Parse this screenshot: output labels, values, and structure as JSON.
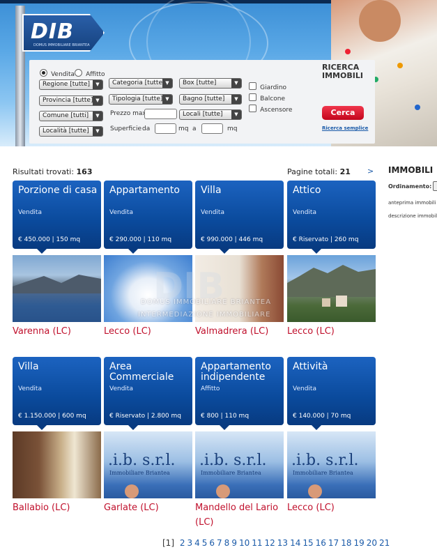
{
  "header": {
    "logo": "DIB",
    "logo_sub": "DOMUS IMMOBILIARE BRIANTEA",
    "search_title": "RICERCA IMMOBILI",
    "search_button": "Cerca",
    "simple_search_link": "Ricerca semplice",
    "radio": [
      {
        "label": "Vendita",
        "checked": true
      },
      {
        "label": "Affitto",
        "checked": false
      }
    ],
    "selects": {
      "regione": "Regione [tutte]",
      "provincia": "Provincia [tutte]",
      "comune": "Comune [tutti]",
      "localita": "Località [tutte]",
      "categoria": "Categoria [tutte]",
      "tipologia": "Tipologia [tutte]",
      "box": "Box [tutte]",
      "bagno": "Bagno [tutte]",
      "locali": "Locali [tutte]"
    },
    "labels": {
      "prezzo_max": "Prezzo max",
      "superficie": "Superficie",
      "da": "da",
      "mq1": "mq",
      "a": "a",
      "mq2": "mq"
    },
    "checkboxes": [
      "Giardino",
      "Balcone",
      "Ascensore"
    ]
  },
  "results": {
    "found_label": "Risultati trovati:",
    "found_count": "163",
    "pages_label": "Pagine totali:",
    "pages_count": "21",
    "next": ">"
  },
  "listings": [
    {
      "title": "Porzione di casa",
      "tipo": "Vendita",
      "price": "€ 450.000 | 150 mq",
      "city": "Varenna (LC)"
    },
    {
      "title": "Appartamento",
      "tipo": "Vendita",
      "price": "€ 290.000 | 110 mq",
      "city": "Lecco (LC)"
    },
    {
      "title": "Villa",
      "tipo": "Vendita",
      "price": "€ 990.000 | 446 mq",
      "city": "Valmadrera (LC)"
    },
    {
      "title": "Attico",
      "tipo": "Vendita",
      "price": "€ Riservato | 260 mq",
      "city": "Lecco (LC)"
    },
    {
      "title": "Villa",
      "tipo": "Vendita",
      "price": "€ 1.150.000 | 600 mq",
      "city": "Ballabio (LC)"
    },
    {
      "title": "Area Commerciale",
      "tipo": "Vendita",
      "price": "€ Riservato | 2.800 mq",
      "city": "Garlate (LC)"
    },
    {
      "title": "Appartamento indipendente",
      "tipo": "Affitto",
      "price": "€ 800 | 110 mq",
      "city": "Mandello del Lario (LC)"
    },
    {
      "title": "Attività",
      "tipo": "Vendita",
      "price": "€ 140.000 | 70 mq",
      "city": "Lecco (LC)"
    }
  ],
  "watermark": {
    "line1": "DOMUS IMMOBILIARE BRIANTEA",
    "line2": "INTERMEDIAZIONE IMMOBILIARE"
  },
  "pagination": {
    "current": "[1]",
    "pages": [
      "2",
      "3",
      "4",
      "5",
      "6",
      "7",
      "8",
      "9",
      "10",
      "11",
      "12",
      "13",
      "14",
      "15",
      "16",
      "17",
      "18",
      "19",
      "20",
      "21"
    ]
  },
  "sidebar": {
    "title": "IMMOBILI",
    "ordinamento": "Ordinamento:",
    "link1": "anteprima immobili",
    "link2": "descrizione immobili"
  },
  "colors": {
    "card_blue": "#0a4a9c",
    "city_red": "#c0102c",
    "cerca_red": "#d40a24"
  }
}
